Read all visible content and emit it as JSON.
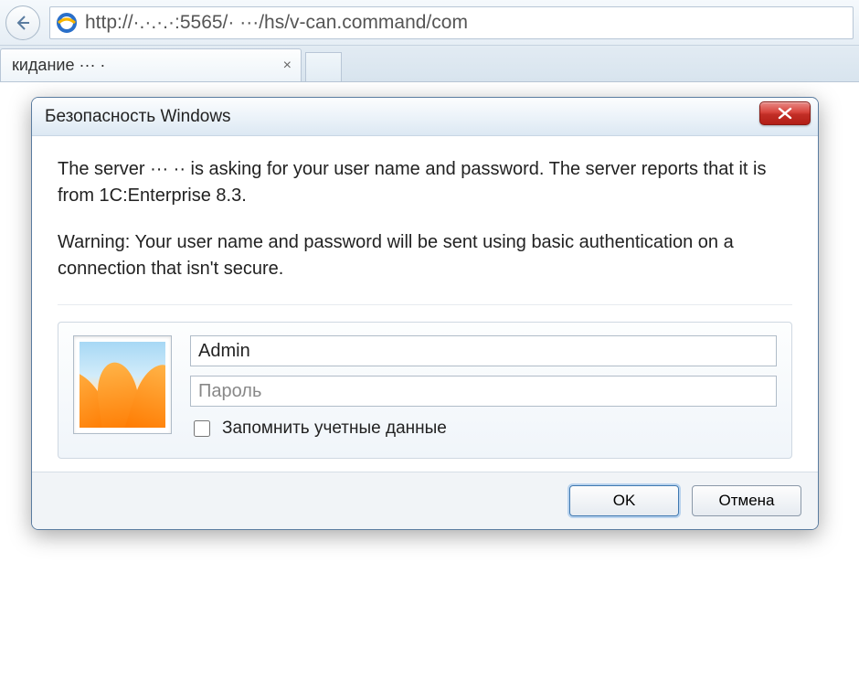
{
  "browser": {
    "url": "http://·.·.·.·:5565/·   ···/hs/v-can.command/com",
    "tab_title": "кидание ··· ·",
    "tab_close_glyph": "×"
  },
  "dialog": {
    "title": "Безопасность Windows",
    "message1": "The server ··· ·· is asking for your user name and password. The server reports that it is from 1C:Enterprise 8.3.",
    "message2": "Warning: Your user name and password will be sent using basic authentication on a connection that isn't secure.",
    "username_value": "Admin",
    "password_placeholder": "Пароль",
    "remember_label": "Запомнить учетные данные",
    "ok_label": "OK",
    "cancel_label": "Отмена"
  }
}
